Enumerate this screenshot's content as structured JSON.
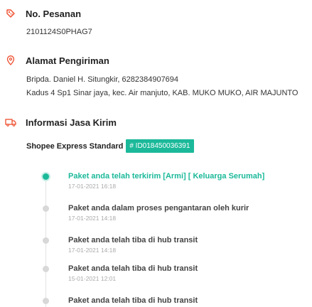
{
  "order": {
    "section_title": "No. Pesanan",
    "number": "2101124S0PHAG7",
    "icon": "tag-icon"
  },
  "address": {
    "section_title": "Alamat Pengiriman",
    "recipient": "Bripda. Daniel H. Situngkir, 6282384907694",
    "line": "Kadus 4 Sp1 Sinar jaya, kec. Air manjuto, KAB. MUKO MUKO, AIR MAJUNTO",
    "icon": "location-pin-icon"
  },
  "shipping": {
    "section_title": "Informasi Jasa Kirim",
    "courier": "Shopee Express Standard",
    "tracking": "# ID018450036391",
    "icon": "truck-icon",
    "accent": "#1bb99a"
  },
  "timeline": [
    {
      "status": "Paket anda telah terkirim [Armi] [ Keluarga Serumah]",
      "time": "17-01-2021 16:18"
    },
    {
      "status": "Paket anda dalam proses pengantaran oleh kurir",
      "time": "17-01-2021 14:18"
    },
    {
      "status": "Paket anda telah tiba di hub transit",
      "time": "17-01-2021 14:18"
    },
    {
      "status": "Paket anda telah tiba di hub transit",
      "time": "15-01-2021 12:01"
    },
    {
      "status": "Paket anda telah tiba di hub transit",
      "time": ""
    }
  ]
}
